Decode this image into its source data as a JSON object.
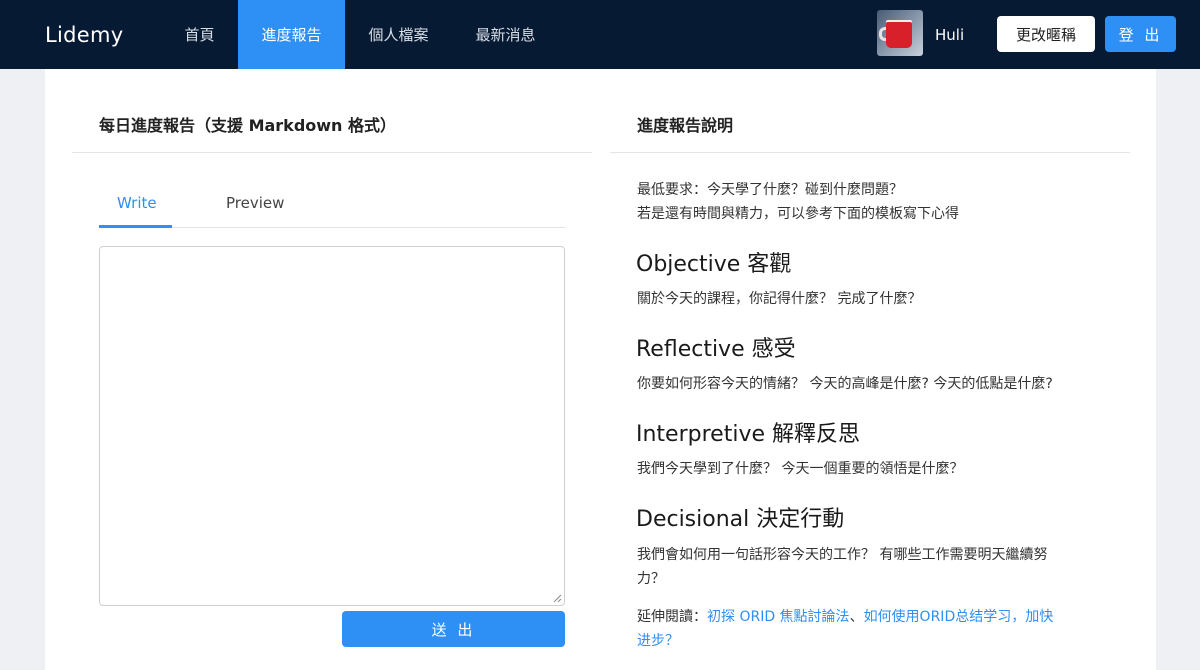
{
  "nav": {
    "brand": "Lidemy",
    "items": [
      "首頁",
      "進度報告",
      "個人檔案",
      "最新消息"
    ],
    "active_index": 1,
    "username": "Huli",
    "change_nickname": "更改暱稱",
    "logout": "登 出"
  },
  "left": {
    "title": "每日進度報告（支援 Markdown 格式）",
    "tabs": [
      "Write",
      "Preview"
    ],
    "active_tab": "Write",
    "editor_value": "",
    "submit": "送 出"
  },
  "right": {
    "title": "進度報告說明",
    "intro_line1": "最低要求：今天學了什麼？碰到什麼問題？",
    "intro_line2": "若是還有時間與精力，可以參考下面的模板寫下心得",
    "sections": [
      {
        "heading": "Objective 客觀",
        "body": "關於今天的課程，你記得什麼？ 完成了什麼？"
      },
      {
        "heading": "Reflective 感受",
        "body": "你要如何形容今天的情緒？ 今天的高峰是什麼? 今天的低點是什麼?"
      },
      {
        "heading": "Interpretive 解釋反思",
        "body": "我們今天學到了什麼？ 今天一個重要的領悟是什麼？"
      },
      {
        "heading": "Decisional 決定行動",
        "body_line1": "我們會如何用一句話形容今天的工作？ 有哪些工作需要明天繼續努",
        "body_line2": "力？"
      }
    ],
    "further_reading_label": "延伸閱讀：",
    "link1": "初探 ORID 焦點討論法",
    "separator": "、",
    "link2_line1": "如何使用ORID总结学习，加快",
    "link2_line2": "进步？"
  },
  "colors": {
    "nav_bg": "#061a33",
    "accent": "#2e8ff4",
    "page_bg": "#eef0f3"
  }
}
